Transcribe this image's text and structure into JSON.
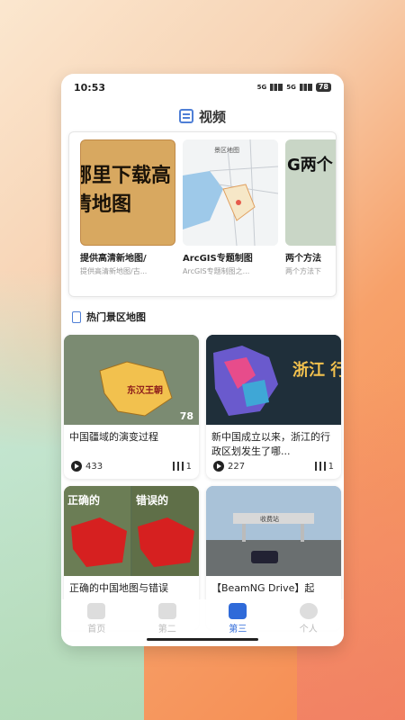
{
  "status_bar": {
    "time": "10:53",
    "signal1": "5G",
    "signal2": "5G",
    "battery": "78"
  },
  "header": {
    "title": "视频"
  },
  "videos": [
    {
      "title": "提供高清新地图/",
      "subtitle": "提供高清新地图/古...",
      "thumb_text": "哪里下载高清地图"
    },
    {
      "title": "ArcGIS专题制图",
      "subtitle": "ArcGIS专题制图之...",
      "thumb_text": "景区地图"
    },
    {
      "title": "两个方法",
      "subtitle": "两个方法下",
      "thumb_text": "G两个"
    }
  ],
  "section": {
    "title": "热门景区地图"
  },
  "grid": [
    {
      "title": "中国疆域的演变过程",
      "plays": "433",
      "count": "1",
      "thumb_text": "东汉王朝",
      "duration": "78"
    },
    {
      "title": "新中国成立以来，浙江的行政区划发生了哪...",
      "plays": "227",
      "count": "1",
      "thumb_text": "浙江 行政区划"
    },
    {
      "title": "正确的中国地图与错误",
      "thumb_left": "正确的",
      "thumb_right": "错误的"
    },
    {
      "title": "【BeamNG Drive】起",
      "thumb_text": "收费站"
    }
  ],
  "tabs": [
    {
      "label": "首页",
      "active": false
    },
    {
      "label": "第二",
      "active": false
    },
    {
      "label": "第三",
      "active": true
    },
    {
      "label": "个人",
      "active": false
    }
  ],
  "colors": {
    "accent": "#2f6ad9",
    "brand_icon": "#4f7fd6"
  }
}
